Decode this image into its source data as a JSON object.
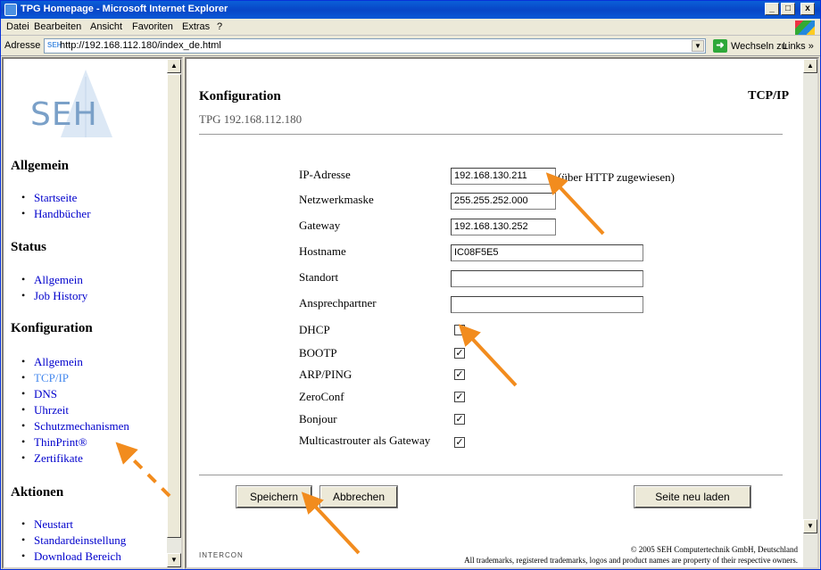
{
  "window": {
    "title": "TPG Homepage - Microsoft Internet Explorer",
    "minimize": "_",
    "maximize": "□",
    "close": "x"
  },
  "menu": [
    "Datei",
    "Bearbeiten",
    "Ansicht",
    "Favoriten",
    "Extras",
    "?"
  ],
  "address": {
    "label": "Adresse",
    "favicon": "SEH",
    "url": "http://192.168.112.180/index_de.html",
    "go_label": "Wechseln zu",
    "links_label": "Links »"
  },
  "sidebar": {
    "logo_text": "SEH",
    "sections": [
      {
        "title": "Allgemein",
        "items": [
          "Startseite",
          "Handbücher"
        ]
      },
      {
        "title": "Status",
        "items": [
          "Allgemein",
          "Job History"
        ]
      },
      {
        "title": "Konfiguration",
        "items": [
          "Allgemein",
          "TCP/IP",
          "DNS",
          "Uhrzeit",
          "Schutzmechanismen",
          "ThinPrint®",
          "Zertifikate"
        ]
      },
      {
        "title": "Aktionen",
        "items": [
          "Neustart",
          "Standardeinstellung",
          "Download Bereich"
        ]
      }
    ]
  },
  "main": {
    "title": "Konfiguration",
    "subtitle": "TPG 192.168.112.180",
    "section": "TCP/IP",
    "fields": [
      {
        "label": "IP-Adresse",
        "value": "192.168.130.211",
        "note": "(über HTTP zugewiesen)"
      },
      {
        "label": "Netzwerkmaske",
        "value": "255.255.252.000"
      },
      {
        "label": "Gateway",
        "value": "192.168.130.252"
      },
      {
        "label": "Hostname",
        "value": "IC08F5E5"
      },
      {
        "label": "Standort",
        "value": ""
      },
      {
        "label": "Ansprechpartner",
        "value": ""
      }
    ],
    "checks": [
      {
        "label": "DHCP",
        "checked": false
      },
      {
        "label": "BOOTP",
        "checked": true
      },
      {
        "label": "ARP/PING",
        "checked": true
      },
      {
        "label": "ZeroConf",
        "checked": true
      },
      {
        "label": "Bonjour",
        "checked": true
      },
      {
        "label": "Multicastrouter als Gateway",
        "checked": true
      }
    ],
    "buttons": {
      "save": "Speichern",
      "cancel": "Abbrechen",
      "reload": "Seite neu laden"
    },
    "footer": {
      "logo": "INTERCON",
      "copyright": "© 2005 SEH Computertechnik GmbH, Deutschland",
      "trademark": "All trademarks, registered trademarks, logos and product names are property of their respective owners."
    }
  },
  "colors": {
    "arrow": "#f28c1e",
    "link": "#0000cc",
    "active_link": "#4488ee"
  }
}
